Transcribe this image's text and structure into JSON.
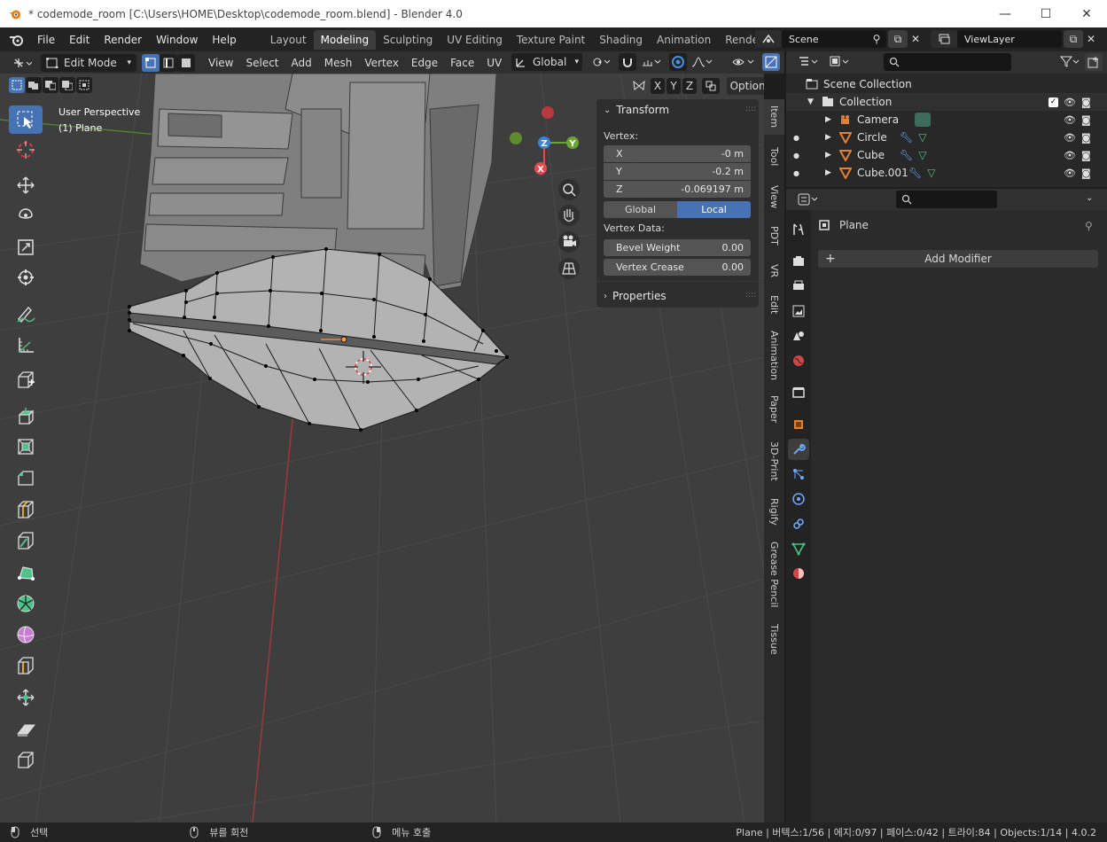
{
  "window": {
    "title": "* codemode_room [C:\\Users\\HOME\\Desktop\\codemode_room.blend] - Blender 4.0",
    "minimize": "—",
    "maximize": "☐",
    "close": "✕"
  },
  "menubar": {
    "menus": [
      "File",
      "Edit",
      "Render",
      "Window",
      "Help"
    ],
    "workspaces": [
      "Layout",
      "Modeling",
      "Sculpting",
      "UV Editing",
      "Texture Paint",
      "Shading",
      "Animation",
      "Rendering"
    ],
    "active_workspace": "Modeling",
    "scene": "Scene",
    "view_layer": "ViewLayer"
  },
  "viewport_header": {
    "mode": "Edit Mode",
    "menus": [
      "View",
      "Select",
      "Add",
      "Mesh",
      "Vertex",
      "Edge",
      "Face",
      "UV"
    ],
    "orientation": "Global",
    "axes": [
      "X",
      "Y",
      "Z"
    ],
    "options": "Options"
  },
  "viewport": {
    "perspective": "User Perspective",
    "object": "(1) Plane",
    "gizmo": {
      "z": "Z",
      "y": "Y",
      "x": "X"
    }
  },
  "npanel": {
    "transform_header": "Transform",
    "vertex_label": "Vertex:",
    "x_label": "X",
    "x_value": "-0 m",
    "y_label": "Y",
    "y_value": "-0.2 m",
    "z_label": "Z",
    "z_value": "-0.069197 m",
    "global": "Global",
    "local": "Local",
    "vertex_data_label": "Vertex Data:",
    "bevel_weight_label": "Bevel Weight",
    "bevel_weight_value": "0.00",
    "vertex_crease_label": "Vertex Crease",
    "vertex_crease_value": "0.00",
    "properties_header": "Properties"
  },
  "side_tabs": [
    "Item",
    "Tool",
    "View",
    "PDT",
    "VR",
    "Edit",
    "Animation",
    "Paper",
    "3D-Print",
    "Rigify",
    "Grease Pencil",
    "Tissue"
  ],
  "outliner": {
    "scene_collection": "Scene Collection",
    "collection": "Collection",
    "items": [
      "Camera",
      "Circle",
      "Cube",
      "Cube.001"
    ]
  },
  "properties": {
    "object_name": "Plane",
    "add_modifier": "Add Modifier"
  },
  "statusbar": {
    "select": "선택",
    "rotate_view": "뷰를 회전",
    "call_menu": "메뉴 호출",
    "stats": "Plane | 버텍스:1/56 | 에지:0/97 | 페이스:0/42 | 트라이:84 | Objects:1/14 | 4.0.2"
  },
  "colors": {
    "accent": "#4772b3",
    "header": "#303030",
    "viewport": "#3e3e3e",
    "axis_x": "#e8484f",
    "axis_y": "#6aa533",
    "axis_z": "#3b82d6",
    "object_orange": "#e0813a"
  }
}
